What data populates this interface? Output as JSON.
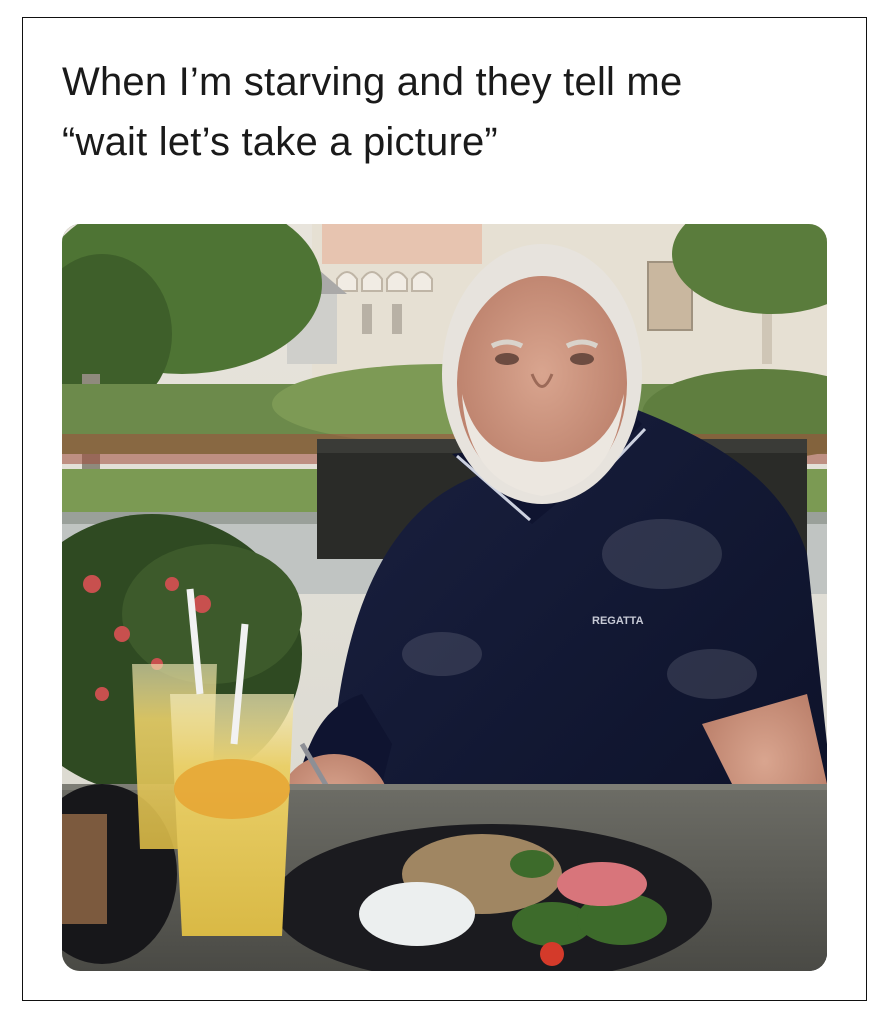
{
  "meme": {
    "caption_line1": "When I’m starving and they tell me",
    "caption_line2": "“wait let’s take a picture”"
  },
  "photo": {
    "subject": "older man with white hair and beard in navy polo shirt seated at outdoor table with a plate of food and two iced drinks",
    "shirt_logo_text": "REGATTA"
  },
  "colors": {
    "frame_border": "#111111",
    "caption_text": "#1a1a1a",
    "shirt": "#141a33",
    "foliage": "#4f6b34",
    "drink": "#e8c85a"
  }
}
